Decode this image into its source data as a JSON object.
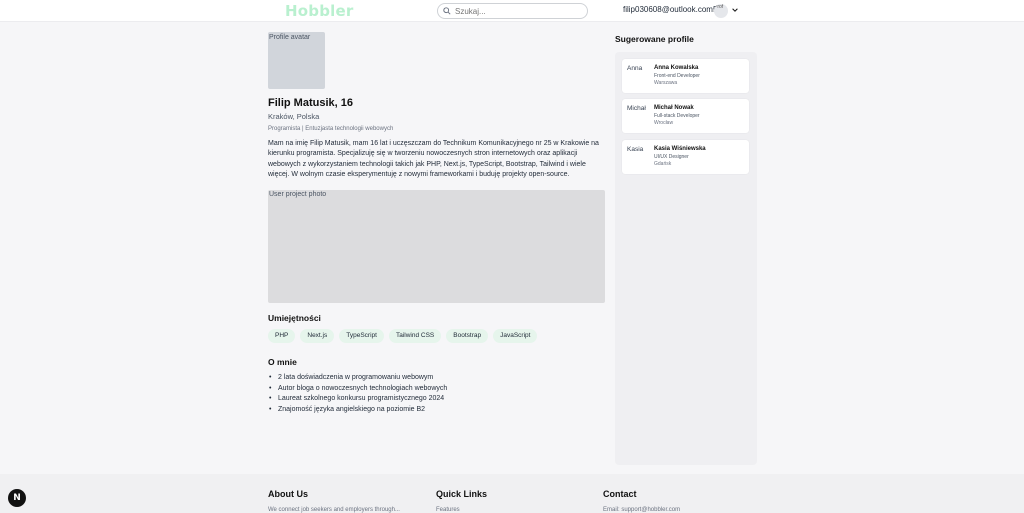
{
  "header": {
    "logo": "Hobbler",
    "search_placeholder": "Szukaj...",
    "user_email": "filip030608@outlook.com5",
    "user_avatar_alt": "Prof"
  },
  "profile": {
    "avatar_alt": "Profile avatar",
    "name": "Filip Matusik, 16",
    "location": "Kraków, Polska",
    "tagline": "Programista | Entuzjasta technologii webowych",
    "bio": "Mam na imię Filip Matusik, mam 16 lat i uczęszczam do Technikum Komunikacyjnego nr 25 w Krakowie na kierunku programista. Specjalizuję się w tworzeniu nowoczesnych stron internetowych oraz aplikacji webowych z wykorzystaniem technologii takich jak PHP, Next.js, TypeScript, Bootstrap, Tailwind i wiele więcej. W wolnym czasie eksperymentuję z nowymi frameworkami i buduję projekty open-source.",
    "project_alt": "User project photo",
    "skills_title": "Umiejętności",
    "skills": [
      "PHP",
      "Next.js",
      "TypeScript",
      "Tailwind CSS",
      "Bootstrap",
      "JavaScript"
    ],
    "about_title": "O mnie",
    "about": [
      "2 lata doświadczenia w programowaniu webowym",
      "Autor bloga o nowoczesnych technologiach webowych",
      "Laureat szkolnego konkursu programistycznego 2024",
      "Znajomość języka angielskiego na poziomie B2"
    ]
  },
  "sidebar": {
    "title": "Sugerowane profile",
    "cards": [
      {
        "img_alt": "Anna",
        "name": "Anna Kowalska",
        "role": "Front-end Developer",
        "city": "Warszawa"
      },
      {
        "img_alt": "Michał",
        "name": "Michał Nowak",
        "role": "Full-stack Developer",
        "city": "Wrocław"
      },
      {
        "img_alt": "Kasia",
        "name": "Kasia Wiśniewska",
        "role": "UI/UX Designer",
        "city": "Gdańsk"
      }
    ]
  },
  "footer": {
    "about_title": "About Us",
    "about_text": "We connect job seekers and employers through...",
    "links_title": "Quick Links",
    "links_text": "Features",
    "contact_title": "Contact",
    "contact_text": "Email: support@hobbler.com"
  },
  "fab_label": "N"
}
